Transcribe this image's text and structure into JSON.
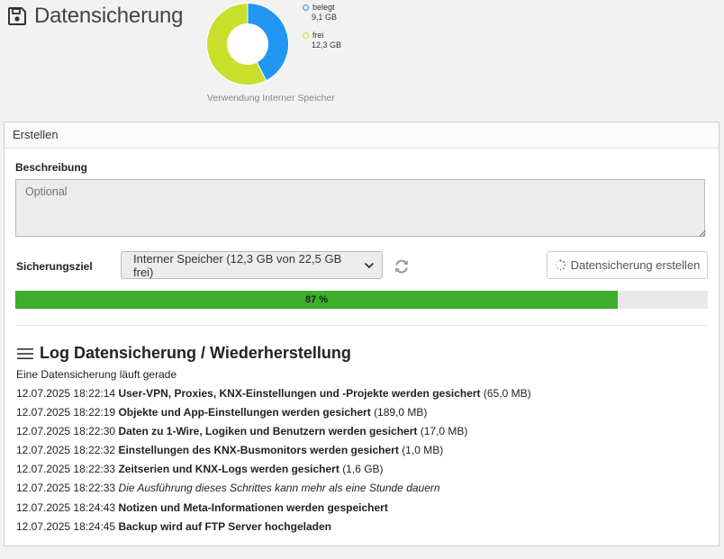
{
  "header": {
    "title": "Datensicherung"
  },
  "chart_data": {
    "type": "pie",
    "title": "Verwendung Interner Speicher",
    "categories": [
      "belegt",
      "frei"
    ],
    "values": [
      9.1,
      12.3
    ],
    "labels": [
      "9,1 GB",
      "12,3 GB"
    ],
    "colors": [
      "#2196f3",
      "#c8df2c"
    ]
  },
  "panel": {
    "heading": "Erstellen",
    "description_label": "Beschreibung",
    "description_placeholder": "Optional",
    "target_label": "Sicherungsziel",
    "target_value": "Interner Speicher (12,3 GB von 22,5 GB frei)",
    "create_button": "Datensicherung erstellen",
    "progress": {
      "value": 87,
      "label": "87 %",
      "color": "#3cae2c"
    }
  },
  "log": {
    "title": "Log Datensicherung / Wiederherstellung",
    "status": "Eine Datensicherung läuft gerade",
    "entries": [
      {
        "time": "12.07.2025 18:22:14",
        "message": "User-VPN, Proxies, KNX-Einstellungen und -Projekte werden gesichert",
        "detail": "(65,0 MB)"
      },
      {
        "time": "12.07.2025 18:22:19",
        "message": "Objekte und App-Einstellungen werden gesichert",
        "detail": "(189,0 MB)"
      },
      {
        "time": "12.07.2025 18:22:30",
        "message": "Daten zu 1-Wire, Logiken und Benutzern werden gesichert",
        "detail": "(17,0 MB)"
      },
      {
        "time": "12.07.2025 18:22:32",
        "message": "Einstellungen des KNX-Busmonitors werden gesichert",
        "detail": "(1,0 MB)"
      },
      {
        "time": "12.07.2025 18:22:33",
        "message": "Zeitserien und KNX-Logs werden gesichert",
        "detail": "(1,6 GB)"
      },
      {
        "time": "12.07.2025 18:22:33",
        "message": "",
        "detail": "",
        "note": "Die Ausführung dieses Schrittes kann mehr als eine Stunde dauern"
      },
      {
        "time": "12.07.2025 18:24:43",
        "message": "Notizen und Meta-Informationen werden gespeichert",
        "detail": ""
      },
      {
        "time": "12.07.2025 18:24:45",
        "message": "Backup wird auf FTP Server hochgeladen",
        "detail": ""
      }
    ]
  }
}
